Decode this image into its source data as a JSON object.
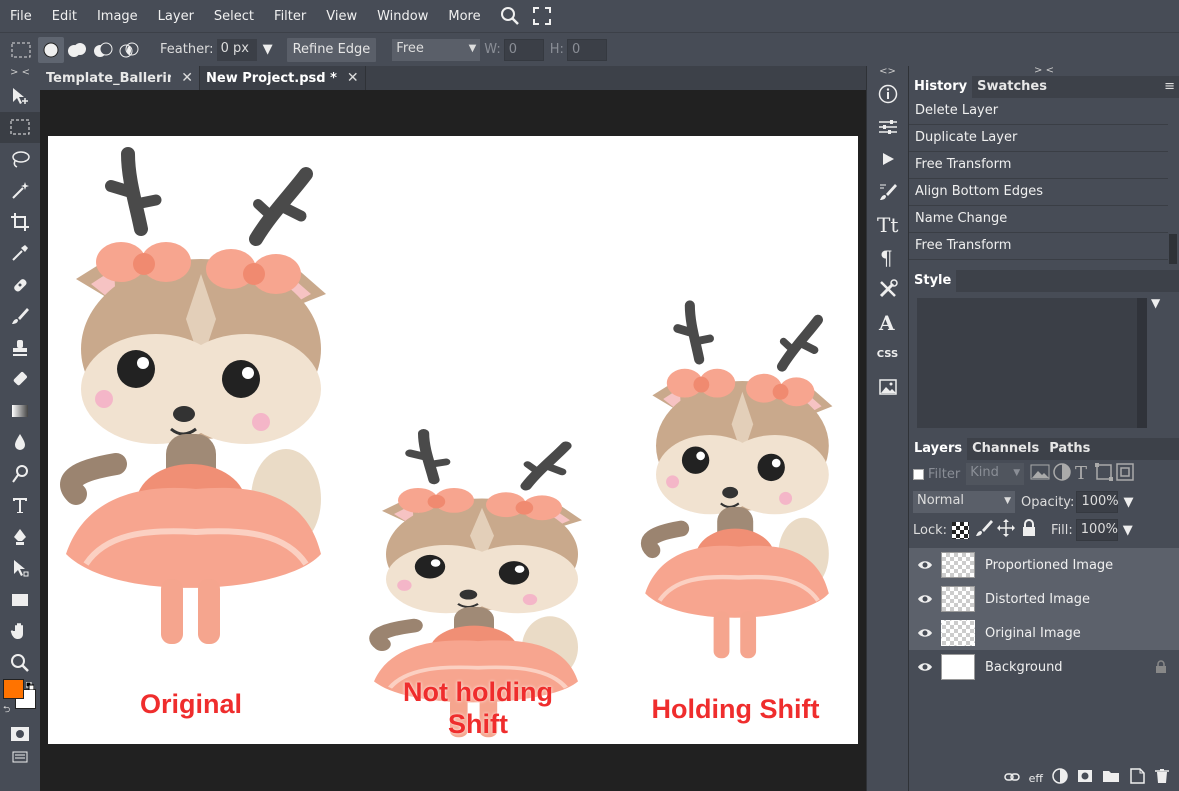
{
  "menu": {
    "items": [
      "File",
      "Edit",
      "Image",
      "Layer",
      "Select",
      "Filter",
      "View",
      "Window",
      "More"
    ]
  },
  "options": {
    "feather_label": "Feather:",
    "feather_value": "0 px",
    "refine_edge": "Refine Edge",
    "style_select": "Free",
    "w_label": "W:",
    "w_value": "0",
    "h_label": "H:",
    "h_value": "0"
  },
  "tabs": [
    {
      "label": "Template_Ballerina"
    },
    {
      "label": "New Project.psd *"
    }
  ],
  "canvas": {
    "captions": {
      "original": "Original",
      "not_holding_1": "Not holding",
      "not_holding_2": "Shift",
      "holding": "Holding Shift"
    }
  },
  "history": {
    "tabs": [
      "History",
      "Swatches"
    ],
    "items": [
      "Delete Layer",
      "Duplicate Layer",
      "Free Transform",
      "Align Bottom Edges",
      "Name Change",
      "Free Transform"
    ]
  },
  "style_panel": {
    "tab": "Style"
  },
  "layers_panel": {
    "tabs": [
      "Layers",
      "Channels",
      "Paths"
    ],
    "filter_label": "Filter",
    "kind_select": "Kind",
    "blend_mode": "Normal",
    "opacity_label": "Opacity:",
    "opacity_value": "100%",
    "lock_label": "Lock:",
    "fill_label": "Fill:",
    "fill_value": "100%",
    "layers": [
      {
        "name": "Proportioned Image"
      },
      {
        "name": "Distorted Image"
      },
      {
        "name": "Original Image"
      },
      {
        "name": "Background"
      }
    ],
    "footer_eff": "eff"
  },
  "right_icons": {
    "css_label": "CSS"
  },
  "colors": {
    "foreground": "#ff7300",
    "background": "#ffffff",
    "caption": "#ef2d2d",
    "deer_tutu": "#f7a58f",
    "deer_fur": "#c9a98c",
    "antler": "#4a4a4a"
  }
}
